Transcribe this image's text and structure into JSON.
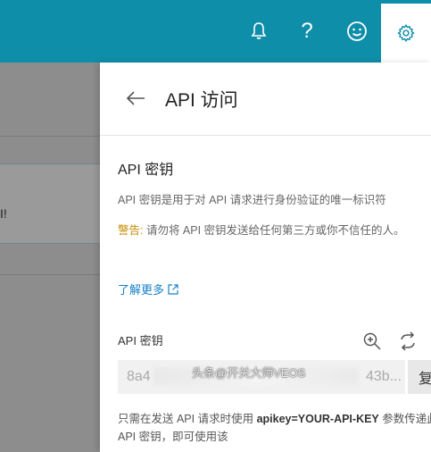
{
  "topbar": {
    "icons": [
      "bell-icon",
      "help-icon",
      "smiley-icon",
      "gear-icon"
    ],
    "help_glyph": "?",
    "accent": "#0f8ea9"
  },
  "background": {
    "partial_text": "I!"
  },
  "panel": {
    "title": "API 访问",
    "section_title": "API 密钥",
    "description": "API 密钥是用于对 API 请求进行身份验证的唯一标识符",
    "warning_label": "警告:",
    "warning_text": " 请勿将 API 密钥发送给任何第三方或你不信任的人。",
    "learn_more": "了解更多",
    "field_label": "API 密钥",
    "key_prefix": "8a4",
    "key_suffix": "43b...",
    "copy_label": "复",
    "note_prefix": "只需在发送 API 请求时使用 ",
    "note_code": "apikey=YOUR-API-KEY",
    "note_suffix": " 参数传递此 API 密钥，即可使用该"
  },
  "watermark": "头条@开关大师VEOS"
}
